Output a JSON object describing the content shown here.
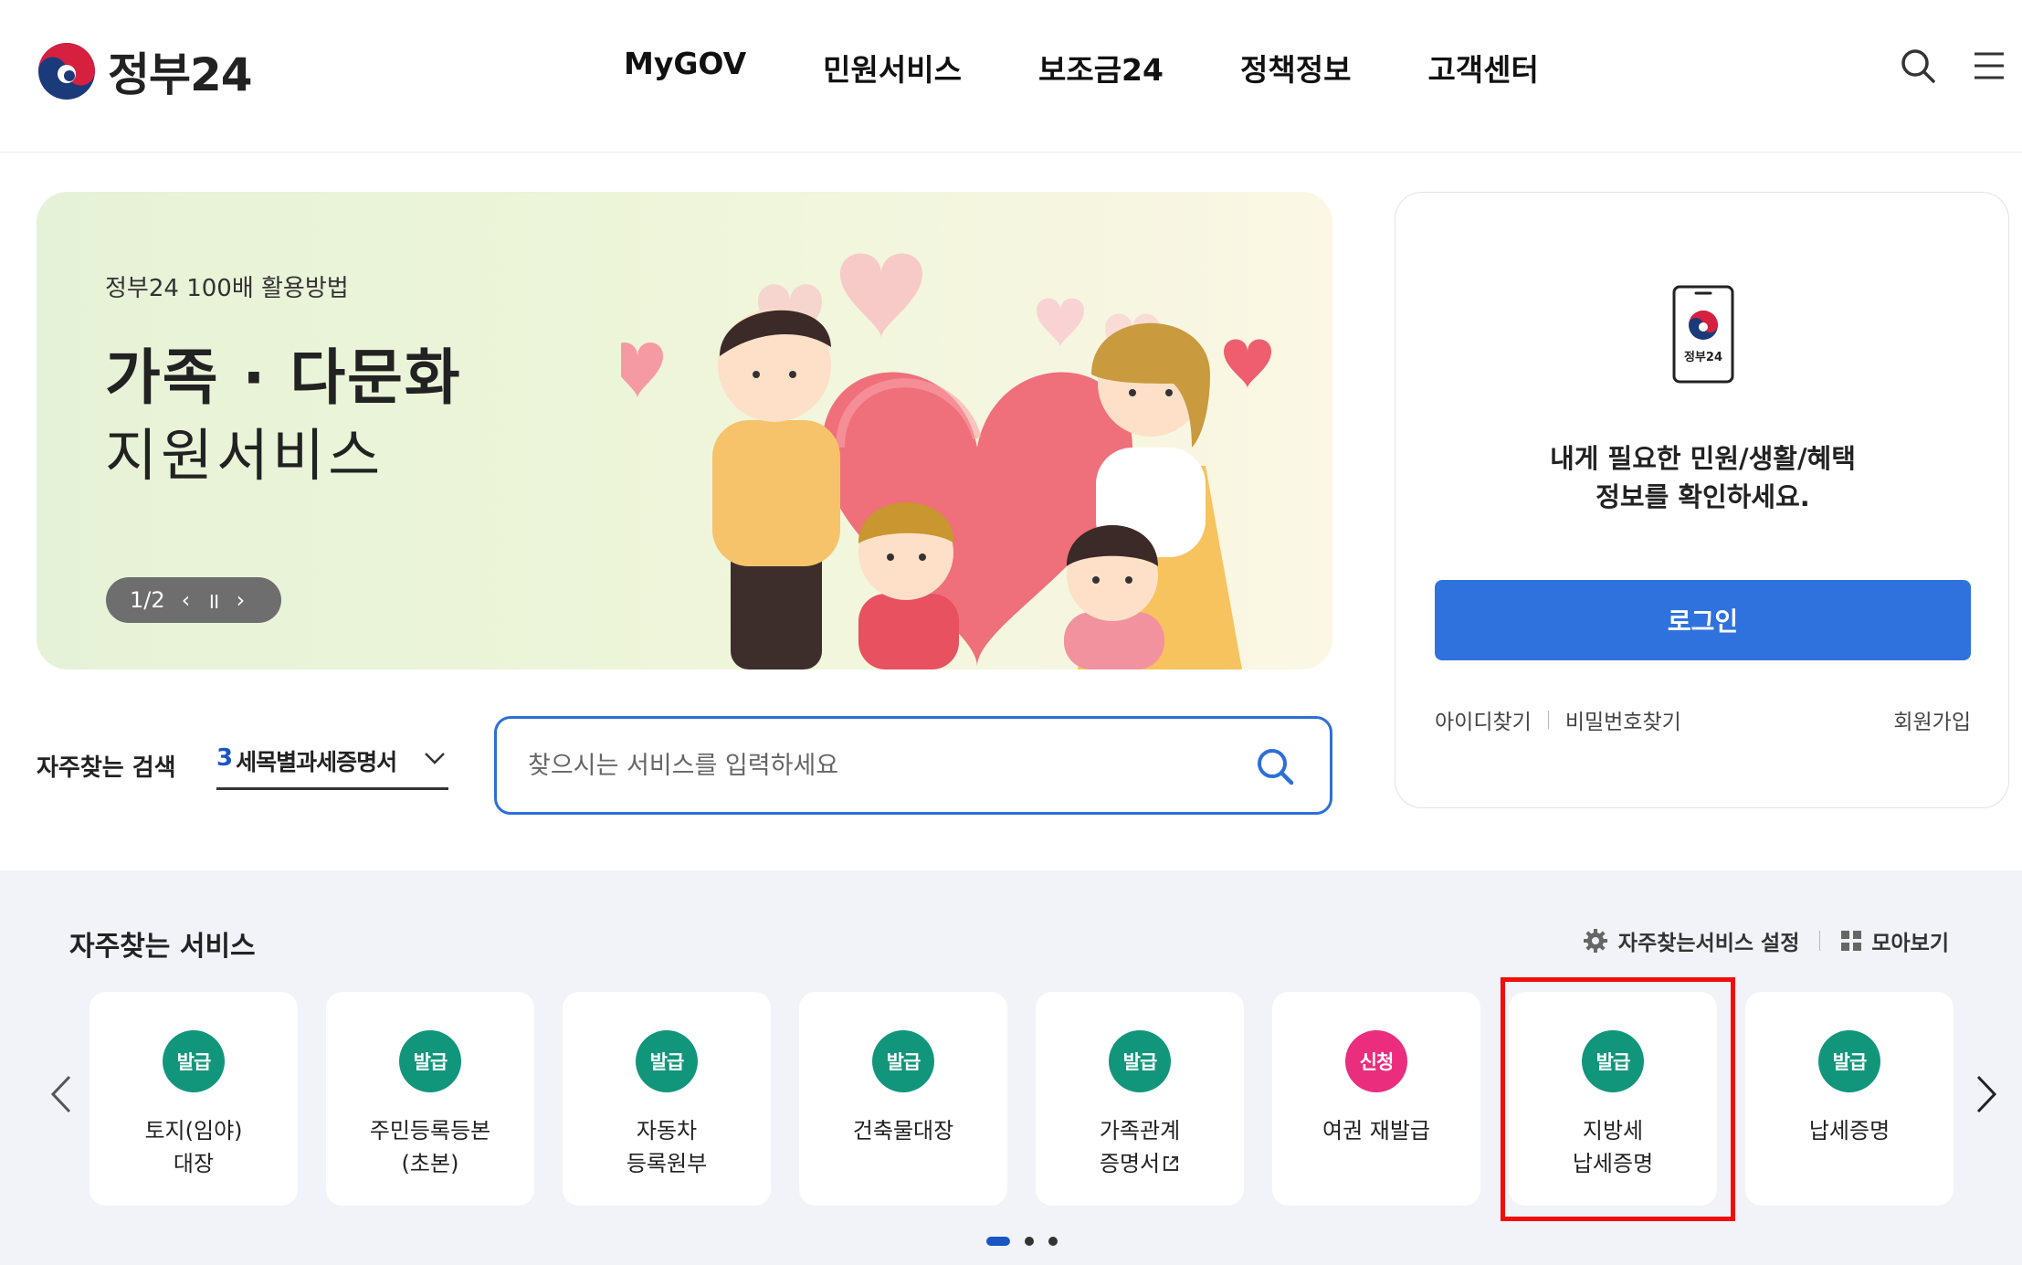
{
  "header": {
    "logo_text": "정부24",
    "nav": [
      "MyGOV",
      "민원서비스",
      "보조금24",
      "정책정보",
      "고객센터"
    ]
  },
  "banner": {
    "eyebrow": "정부24 100배 활용방법",
    "title": "가족 · 다문화",
    "subtitle": "지원서비스",
    "page_indicator": "1/2",
    "prev": "‹",
    "pause": "॥",
    "next": "›"
  },
  "frequent_search": {
    "label": "자주찾는 검색",
    "rank": "3",
    "term": "세목별과세증명서"
  },
  "search": {
    "placeholder": "찾으시는 서비스를 입력하세요",
    "value": ""
  },
  "login": {
    "phone_label": "정부24",
    "message_line1": "내게 필요한 민원/생활/혜택",
    "message_line2": "정보를 확인하세요.",
    "button": "로그인",
    "find_id": "아이디찾기",
    "find_pw": "비밀번호찾기",
    "signup": "회원가입"
  },
  "services": {
    "title": "자주찾는 서비스",
    "settings": "자주찾는서비스 설정",
    "view_all": "모아보기",
    "items": [
      {
        "badge": "발급",
        "label": "토지(임야)\n대장"
      },
      {
        "badge": "발급",
        "label": "주민등록등본\n(초본)"
      },
      {
        "badge": "발급",
        "label": "자동차\n등록원부"
      },
      {
        "badge": "발급",
        "label": "건축물대장"
      },
      {
        "badge": "발급",
        "label": "가족관계\n증명서"
      },
      {
        "badge": "신청",
        "label": "여권 재발급"
      },
      {
        "badge": "발급",
        "label": "지방세\n납세증명"
      },
      {
        "badge": "발급",
        "label": "납세증명"
      }
    ]
  },
  "colors": {
    "primary_blue": "#2f72dd",
    "issue_green": "#12967b",
    "apply_pink": "#ea2d7d",
    "highlight_red": "#f20d0d",
    "services_bg": "#f1f3f8"
  }
}
